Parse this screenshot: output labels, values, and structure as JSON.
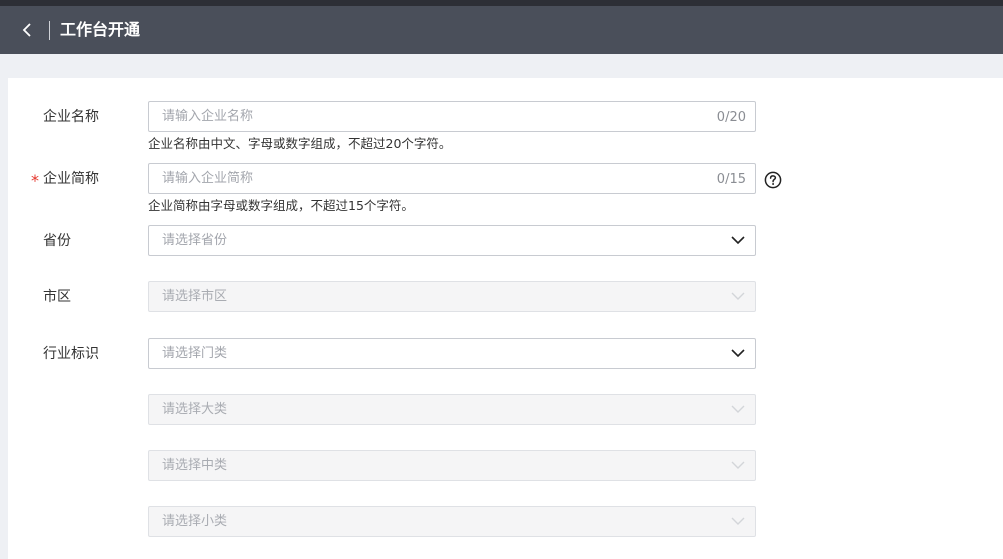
{
  "header": {
    "title": "工作台开通"
  },
  "form": {
    "company_name": {
      "label": "企业名称",
      "placeholder": "请输入企业名称",
      "counter": "0/20",
      "hint": "企业名称由中文、字母或数字组成，不超过20个字符。"
    },
    "company_short_name": {
      "required_mark": "*",
      "label": "企业简称",
      "placeholder": "请输入企业简称",
      "counter": "0/15",
      "hint": "企业简称由字母或数字组成，不超过15个字符。"
    },
    "province": {
      "label": "省份",
      "placeholder": "请选择省份"
    },
    "city": {
      "label": "市区",
      "placeholder": "请选择市区"
    },
    "industry": {
      "label": "行业标识",
      "section_placeholder": "请选择门类",
      "major_placeholder": "请选择大类",
      "middle_placeholder": "请选择中类",
      "minor_placeholder": "请选择小类"
    }
  },
  "icons": {
    "back": "chevron-left-icon",
    "help": "question-circle-icon",
    "dropdown": "chevron-down-icon"
  },
  "colors": {
    "header_bg": "#4a4f5a",
    "required": "#e5352b",
    "page_bg": "#eef0f4"
  }
}
